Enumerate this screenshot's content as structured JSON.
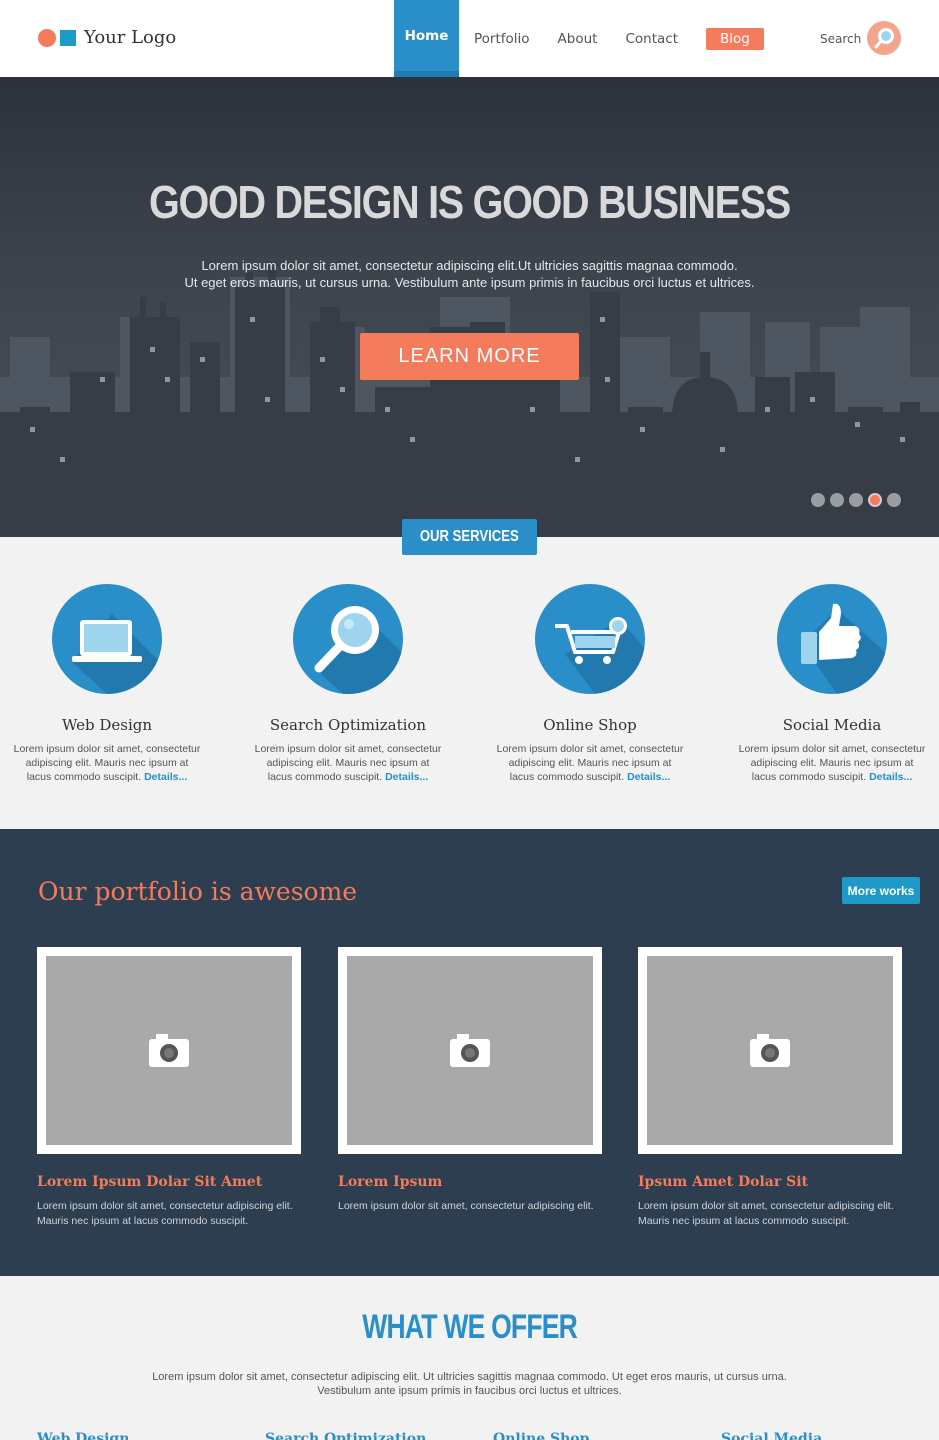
{
  "header": {
    "logo_text": "Your Logo",
    "nav": [
      "Home",
      "Portfolio",
      "About",
      "Contact",
      "Blog"
    ],
    "search_label": "Search"
  },
  "hero": {
    "title": "GOOD DESIGN IS GOOD BUSINESS",
    "text_line1": "Lorem ipsum dolor sit amet, consectetur adipiscing elit.Ut ultricies sagittis magnaa commodo.",
    "text_line2": "Ut eget eros mauris, ut cursus urna. Vestibulum ante ipsum primis in faucibus orci luctus et ultrices.",
    "cta": "LEARN MORE",
    "slides_total": 5,
    "slide_active": 4
  },
  "services": {
    "badge": "OUR SERVICES",
    "items": [
      {
        "title": "Web Design",
        "desc": "Lorem ipsum dolor sit amet, consectetur adipiscing elit. Mauris nec ipsum at lacus commodo suscipit.",
        "link": "Details...",
        "icon": "laptop-icon"
      },
      {
        "title": "Search Optimization",
        "desc": "Lorem ipsum dolor sit amet, consectetur adipiscing elit. Mauris nec ipsum at lacus commodo suscipit.",
        "link": "Details...",
        "icon": "magnifier-icon"
      },
      {
        "title": "Online Shop",
        "desc": "Lorem ipsum dolor sit amet, consectetur adipiscing elit. Mauris nec ipsum at lacus commodo suscipit.",
        "link": "Details...",
        "icon": "shopping-cart-icon"
      },
      {
        "title": "Social Media",
        "desc": "Lorem ipsum dolor sit amet, consectetur adipiscing elit. Mauris nec ipsum at lacus commodo suscipit.",
        "link": "Details...",
        "icon": "thumbs-up-icon"
      }
    ]
  },
  "portfolio": {
    "title": "Our portfolio is awesome",
    "more_button": "More works",
    "cards": [
      {
        "title": "Lorem Ipsum Dolar Sit Amet",
        "desc": "Lorem ipsum dolor sit amet, consectetur adipiscing elit. Mauris nec ipsum at lacus commodo suscipit."
      },
      {
        "title": "Lorem Ipsum",
        "desc": "Lorem ipsum dolor sit amet, consectetur adipiscing elit."
      },
      {
        "title": "Ipsum Amet Dolar Sit",
        "desc": "Lorem ipsum dolor sit amet, consectetur adipiscing elit. Mauris nec ipsum at lacus commodo suscipit."
      }
    ]
  },
  "offer": {
    "title": "WHAT WE OFFER",
    "text_line1": "Lorem ipsum dolor sit amet, consectetur adipiscing elit. Ut ultricies sagittis magnaa commodo. Ut eget eros mauris, ut cursus urna.",
    "text_line2": "Vestibulum ante ipsum primis in faucibus orci luctus et ultrices.",
    "columns": [
      "Web Design",
      "Search Optimization",
      "Online Shop",
      "Social Media"
    ]
  },
  "colors": {
    "accent": "#f47b5c",
    "brand_blue": "#2a8fc9",
    "dark": "#2d3e50"
  }
}
